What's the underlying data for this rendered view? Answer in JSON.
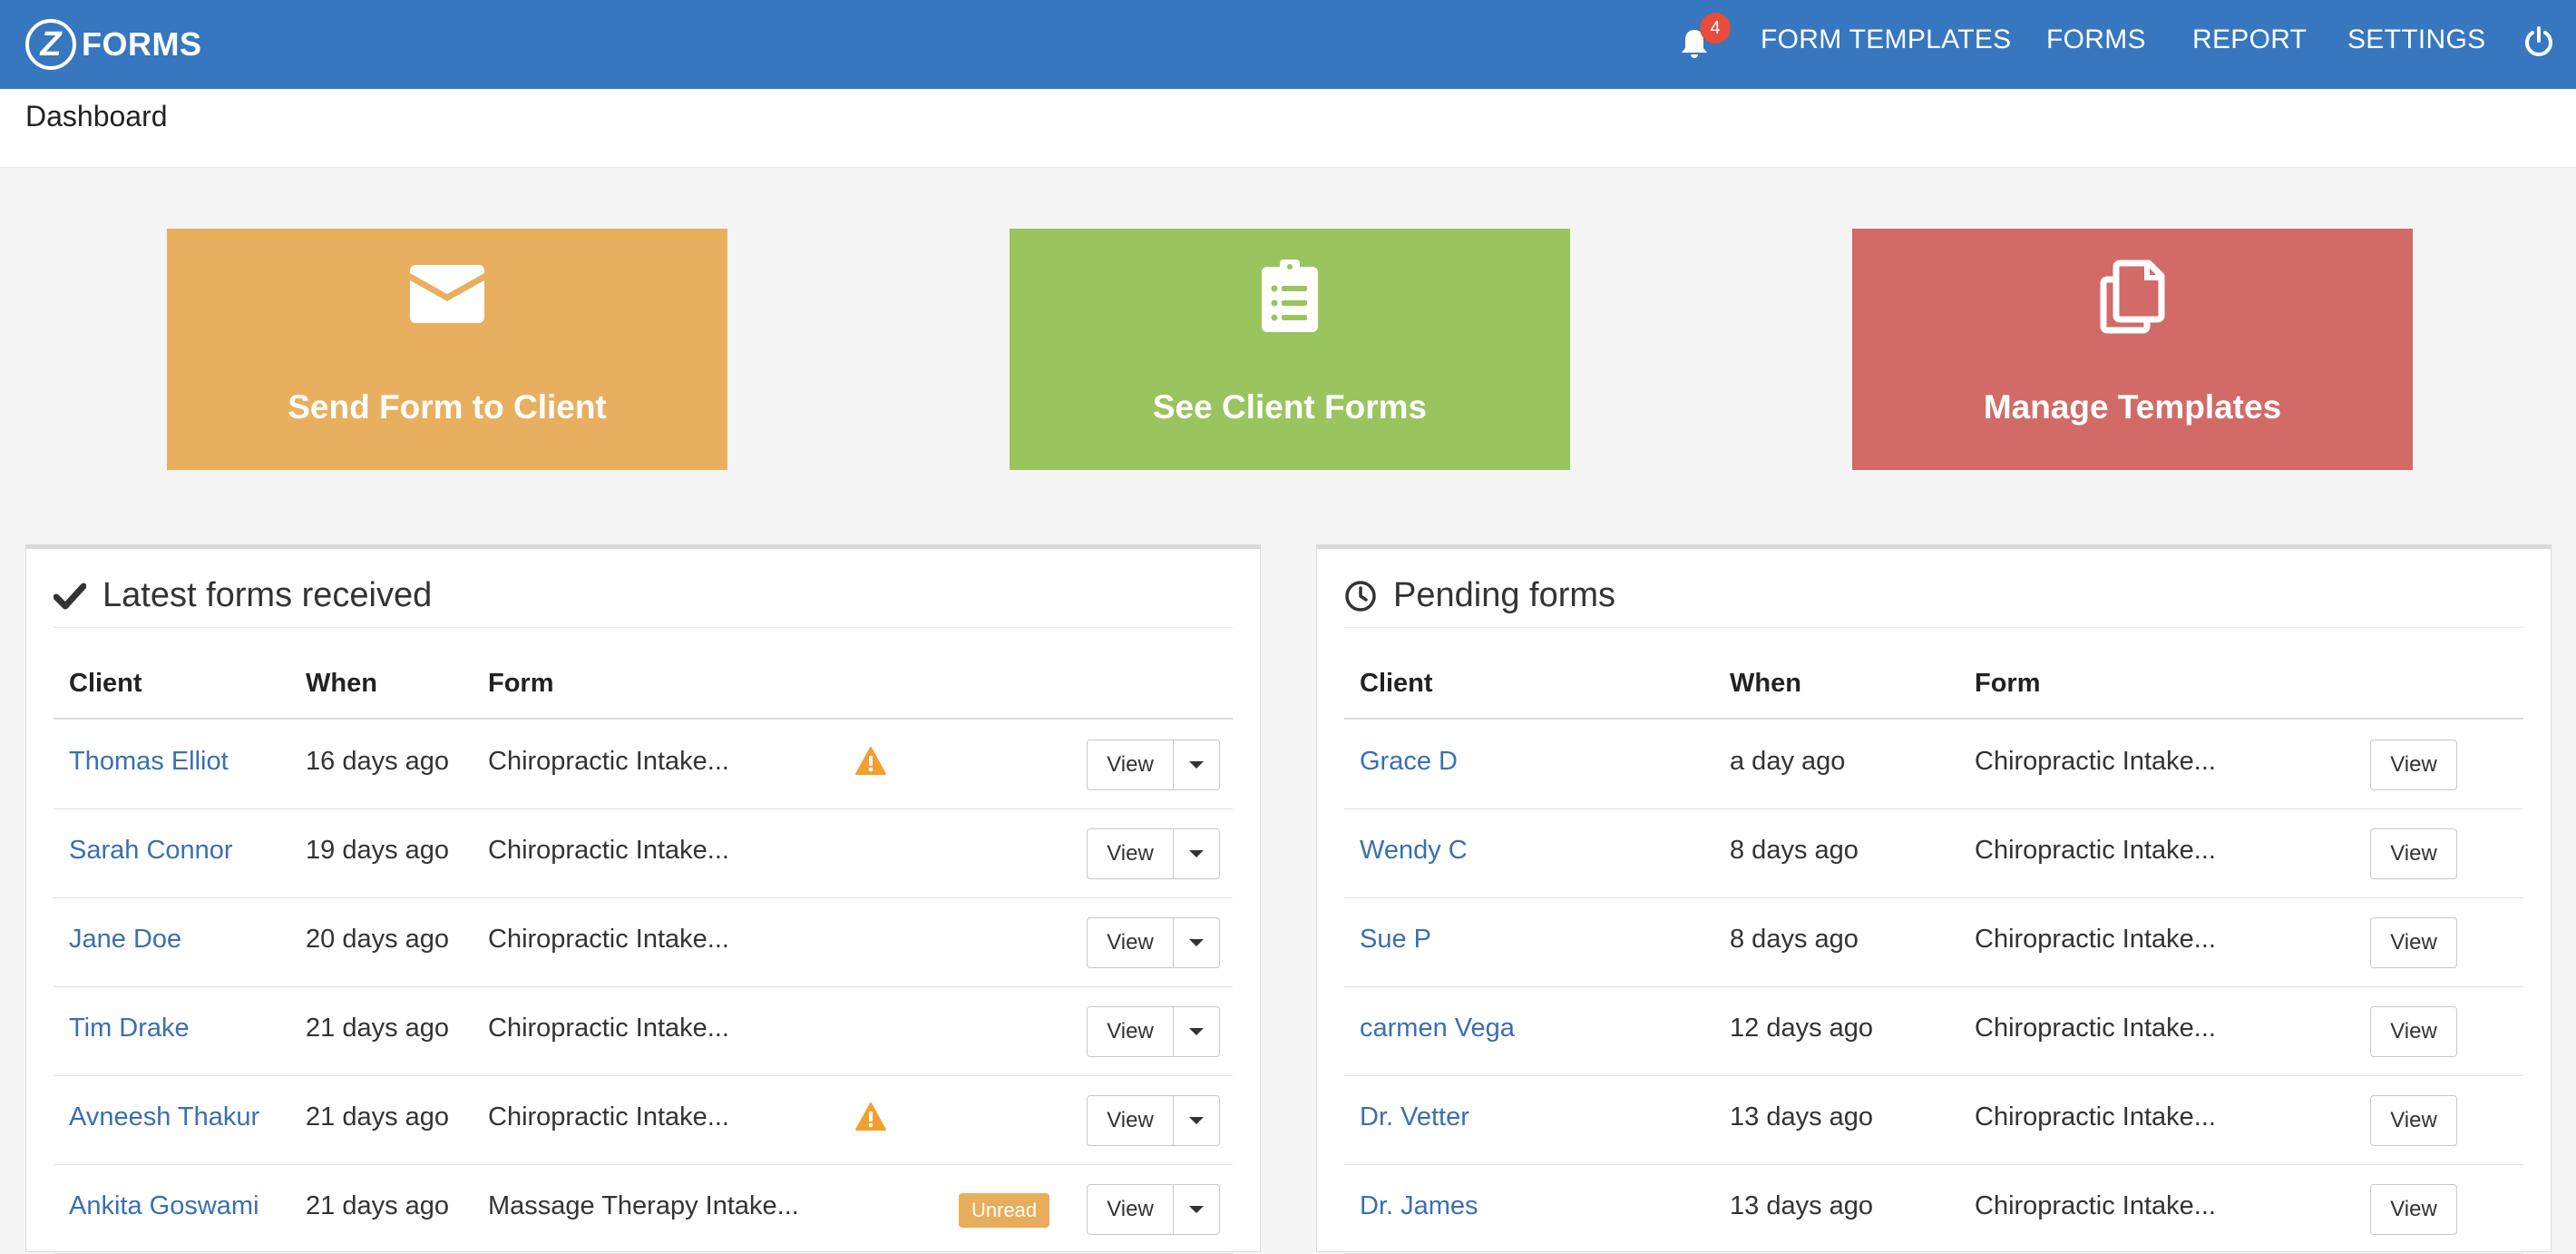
{
  "app": {
    "logo_letter": "Z",
    "logo_text": "FORMS",
    "notification_count": "4",
    "nav": [
      "FORM TEMPLATES",
      "FORMS",
      "REPORT",
      "SETTINGS"
    ]
  },
  "page": {
    "title": "Dashboard"
  },
  "tiles": [
    {
      "label": "Send Form to Client",
      "icon": "envelope-icon",
      "color": "#e8b05e"
    },
    {
      "label": "See Client Forms",
      "icon": "clipboard-list-icon",
      "color": "#9ac45e"
    },
    {
      "label": "Manage Templates",
      "icon": "copy-icon",
      "color": "#d26a68"
    }
  ],
  "latest": {
    "title": "Latest forms received",
    "columns": [
      "Client",
      "When",
      "Form"
    ],
    "view_label": "View",
    "rows": [
      {
        "client": "Thomas Elliot",
        "when": "16 days ago",
        "form": "Chiropractic Intake...",
        "flag": "warning"
      },
      {
        "client": "Sarah Connor",
        "when": "19 days ago",
        "form": "Chiropractic Intake...",
        "flag": ""
      },
      {
        "client": "Jane Doe",
        "when": "20 days ago",
        "form": "Chiropractic Intake...",
        "flag": ""
      },
      {
        "client": "Tim Drake",
        "when": "21 days ago",
        "form": "Chiropractic Intake...",
        "flag": ""
      },
      {
        "client": "Avneesh Thakur",
        "when": "21 days ago",
        "form": "Chiropractic Intake...",
        "flag": "warning"
      },
      {
        "client": "Ankita Goswami",
        "when": "21 days ago",
        "form": "Massage Therapy Intake...",
        "flag": "Unread"
      }
    ]
  },
  "pending": {
    "title": "Pending forms",
    "columns": [
      "Client",
      "When",
      "Form"
    ],
    "view_label": "View",
    "rows": [
      {
        "client": "Grace D",
        "when": "a day ago",
        "form": "Chiropractic Intake..."
      },
      {
        "client": "Wendy C",
        "when": "8 days ago",
        "form": "Chiropractic Intake..."
      },
      {
        "client": "Sue P",
        "when": "8 days ago",
        "form": "Chiropractic Intake..."
      },
      {
        "client": "carmen Vega",
        "when": "12 days ago",
        "form": "Chiropractic Intake..."
      },
      {
        "client": "Dr. Vetter",
        "when": "13 days ago",
        "form": "Chiropractic Intake..."
      },
      {
        "client": "Dr. James",
        "when": "13 days ago",
        "form": "Chiropractic Intake..."
      }
    ]
  },
  "colors": {
    "nav": "#3677bf",
    "link": "#3a6fb0",
    "warning": "#f0a030",
    "badge": "#e74c3c"
  }
}
